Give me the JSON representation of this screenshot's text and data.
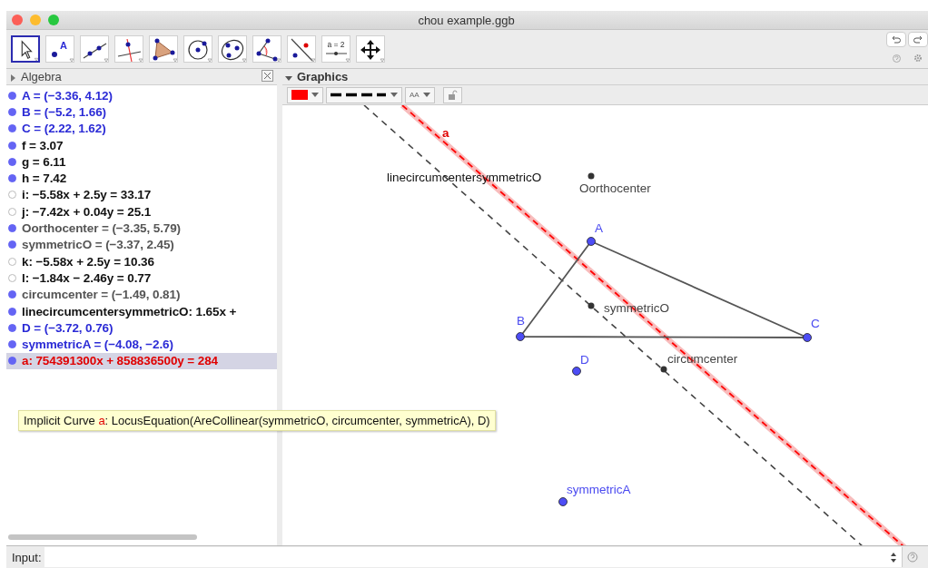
{
  "window": {
    "title": "chou example.ggb"
  },
  "tools": [
    {
      "kind": "move",
      "selected": true
    },
    {
      "kind": "point",
      "glyph": "A",
      "selected": false
    },
    {
      "kind": "line",
      "selected": false
    },
    {
      "kind": "perpendicular",
      "selected": false
    },
    {
      "kind": "polygon",
      "selected": false
    },
    {
      "kind": "circle",
      "selected": false
    },
    {
      "kind": "conic",
      "selected": false
    },
    {
      "kind": "angle",
      "selected": false
    },
    {
      "kind": "reflect",
      "selected": false
    },
    {
      "kind": "slider",
      "glyph": "a = 2",
      "selected": false
    },
    {
      "kind": "pan",
      "selected": false
    }
  ],
  "algebra": {
    "title": "Algebra",
    "expanded": false,
    "items": [
      {
        "text": "A = (−3.36, 4.12)",
        "color": "#2b2bd6",
        "visible": true,
        "selected": false
      },
      {
        "text": "B = (−5.2, 1.66)",
        "color": "#2b2bd6",
        "visible": true,
        "selected": false
      },
      {
        "text": "C = (2.22, 1.62)",
        "color": "#2b2bd6",
        "visible": true,
        "selected": false
      },
      {
        "text": "f = 3.07",
        "color": "#111111",
        "visible": true,
        "selected": false
      },
      {
        "text": "g = 6.11",
        "color": "#111111",
        "visible": true,
        "selected": false
      },
      {
        "text": "h = 7.42",
        "color": "#111111",
        "visible": true,
        "selected": false
      },
      {
        "text": "i: −5.58x + 2.5y = 33.17",
        "color": "#111111",
        "visible": false,
        "selected": false
      },
      {
        "text": "j: −7.42x + 0.04y = 25.1",
        "color": "#111111",
        "visible": false,
        "selected": false
      },
      {
        "text": "Oorthocenter = (−3.35, 5.79)",
        "color": "#555555",
        "visible": true,
        "selected": false
      },
      {
        "text": "symmetricO = (−3.37, 2.45)",
        "color": "#555555",
        "visible": true,
        "selected": false
      },
      {
        "text": "k: −5.58x + 2.5y = 10.36",
        "color": "#111111",
        "visible": false,
        "selected": false
      },
      {
        "text": "l: −1.84x − 2.46y = 0.77",
        "color": "#111111",
        "visible": false,
        "selected": false
      },
      {
        "text": "circumcenter = (−1.49, 0.81)",
        "color": "#555555",
        "visible": true,
        "selected": false
      },
      {
        "text": "linecircumcentersymmetricO: 1.65x +",
        "color": "#111111",
        "visible": true,
        "selected": false
      },
      {
        "text": "D = (−3.72, 0.76)",
        "color": "#2b2bd6",
        "visible": true,
        "selected": false
      },
      {
        "text": "symmetricA = (−4.08, −2.6)",
        "color": "#2b2bd6",
        "visible": true,
        "selected": false
      },
      {
        "text": "a: 754391300x + 858836500y = 284",
        "color": "#e00000",
        "visible": true,
        "selected": true
      }
    ]
  },
  "graphics": {
    "title": "Graphics",
    "expanded": true,
    "style_bar": {
      "color": "#ff0000",
      "text_size": "AA"
    },
    "labels": [
      {
        "text": "a",
        "color": "#e00000"
      },
      {
        "text": "linecircumcentersymmetricO",
        "color": "#111111"
      },
      {
        "text": "Oorthocenter",
        "color": "#444444"
      },
      {
        "text": "A",
        "color": "#4a4af0"
      },
      {
        "text": "B",
        "color": "#4a4af0"
      },
      {
        "text": "C",
        "color": "#4a4af0"
      },
      {
        "text": "symmetricO",
        "color": "#444444"
      },
      {
        "text": "D",
        "color": "#4a4af0"
      },
      {
        "text": "circumcenter",
        "color": "#444444"
      },
      {
        "text": "symmetricA",
        "color": "#4a4af0"
      }
    ]
  },
  "tooltip": {
    "prefix": "Implicit Curve",
    "name": "a",
    "suffix": ": LocusEquation(AreCollinear(symmetricO, circumcenter, symmetricA), D)"
  },
  "input_bar": {
    "label": "Input:"
  }
}
